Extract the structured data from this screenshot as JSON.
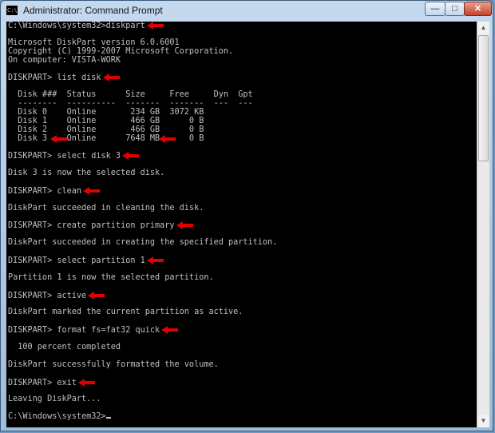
{
  "window": {
    "title": "Administrator: Command Prompt",
    "icon_text": "C:\\",
    "minimize": "—",
    "maximize": "□",
    "close": "✕"
  },
  "colors": {
    "console_bg": "#000000",
    "console_text": "#c0c0c0",
    "arrow": "#e00000"
  },
  "console": {
    "lines": [
      {
        "text": "C:\\Windows\\system32>diskpart",
        "arrow": true
      },
      {
        "text": "",
        "arrow": false
      },
      {
        "text": "Microsoft DiskPart version 6.0.6001",
        "arrow": false
      },
      {
        "text": "Copyright (C) 1999-2007 Microsoft Corporation.",
        "arrow": false
      },
      {
        "text": "On computer: VISTA-WORK",
        "arrow": false
      },
      {
        "text": "",
        "arrow": false
      },
      {
        "text": "DISKPART> list disk",
        "arrow": true
      },
      {
        "text": "",
        "arrow": false
      },
      {
        "text": "  Disk ###  Status      Size     Free     Dyn  Gpt",
        "arrow": false
      },
      {
        "text": "  --------  ----------  -------  -------  ---  ---",
        "arrow": false
      },
      {
        "text": "  Disk 0    Online       234 GB  3072 KB",
        "arrow": false
      },
      {
        "text": "  Disk 1    Online       466 GB      0 B",
        "arrow": false
      },
      {
        "text": "  Disk 2    Online       466 GB      0 B",
        "arrow": false
      },
      {
        "text": "  Disk 3    Online      7648 MB      0 B",
        "arrow": false
      },
      {
        "text": "",
        "arrow": false
      },
      {
        "text": "DISKPART> select disk 3",
        "arrow": true
      },
      {
        "text": "",
        "arrow": false
      },
      {
        "text": "Disk 3 is now the selected disk.",
        "arrow": false
      },
      {
        "text": "",
        "arrow": false
      },
      {
        "text": "DISKPART> clean",
        "arrow": true
      },
      {
        "text": "",
        "arrow": false
      },
      {
        "text": "DiskPart succeeded in cleaning the disk.",
        "arrow": false
      },
      {
        "text": "",
        "arrow": false
      },
      {
        "text": "DISKPART> create partition primary",
        "arrow": true
      },
      {
        "text": "",
        "arrow": false
      },
      {
        "text": "DiskPart succeeded in creating the specified partition.",
        "arrow": false
      },
      {
        "text": "",
        "arrow": false
      },
      {
        "text": "DISKPART> select partition 1",
        "arrow": true
      },
      {
        "text": "",
        "arrow": false
      },
      {
        "text": "Partition 1 is now the selected partition.",
        "arrow": false
      },
      {
        "text": "",
        "arrow": false
      },
      {
        "text": "DISKPART> active",
        "arrow": true
      },
      {
        "text": "",
        "arrow": false
      },
      {
        "text": "DiskPart marked the current partition as active.",
        "arrow": false
      },
      {
        "text": "",
        "arrow": false
      },
      {
        "text": "DISKPART> format fs=fat32 quick",
        "arrow": true
      },
      {
        "text": "",
        "arrow": false
      },
      {
        "text": "  100 percent completed",
        "arrow": false
      },
      {
        "text": "",
        "arrow": false
      },
      {
        "text": "DiskPart successfully formatted the volume.",
        "arrow": false
      },
      {
        "text": "",
        "arrow": false
      },
      {
        "text": "DISKPART> exit",
        "arrow": true
      },
      {
        "text": "",
        "arrow": false
      },
      {
        "text": "Leaving DiskPart...",
        "arrow": false
      },
      {
        "text": "",
        "arrow": false
      },
      {
        "text": "C:\\Windows\\system32>",
        "arrow": false,
        "cursor": true
      }
    ]
  }
}
